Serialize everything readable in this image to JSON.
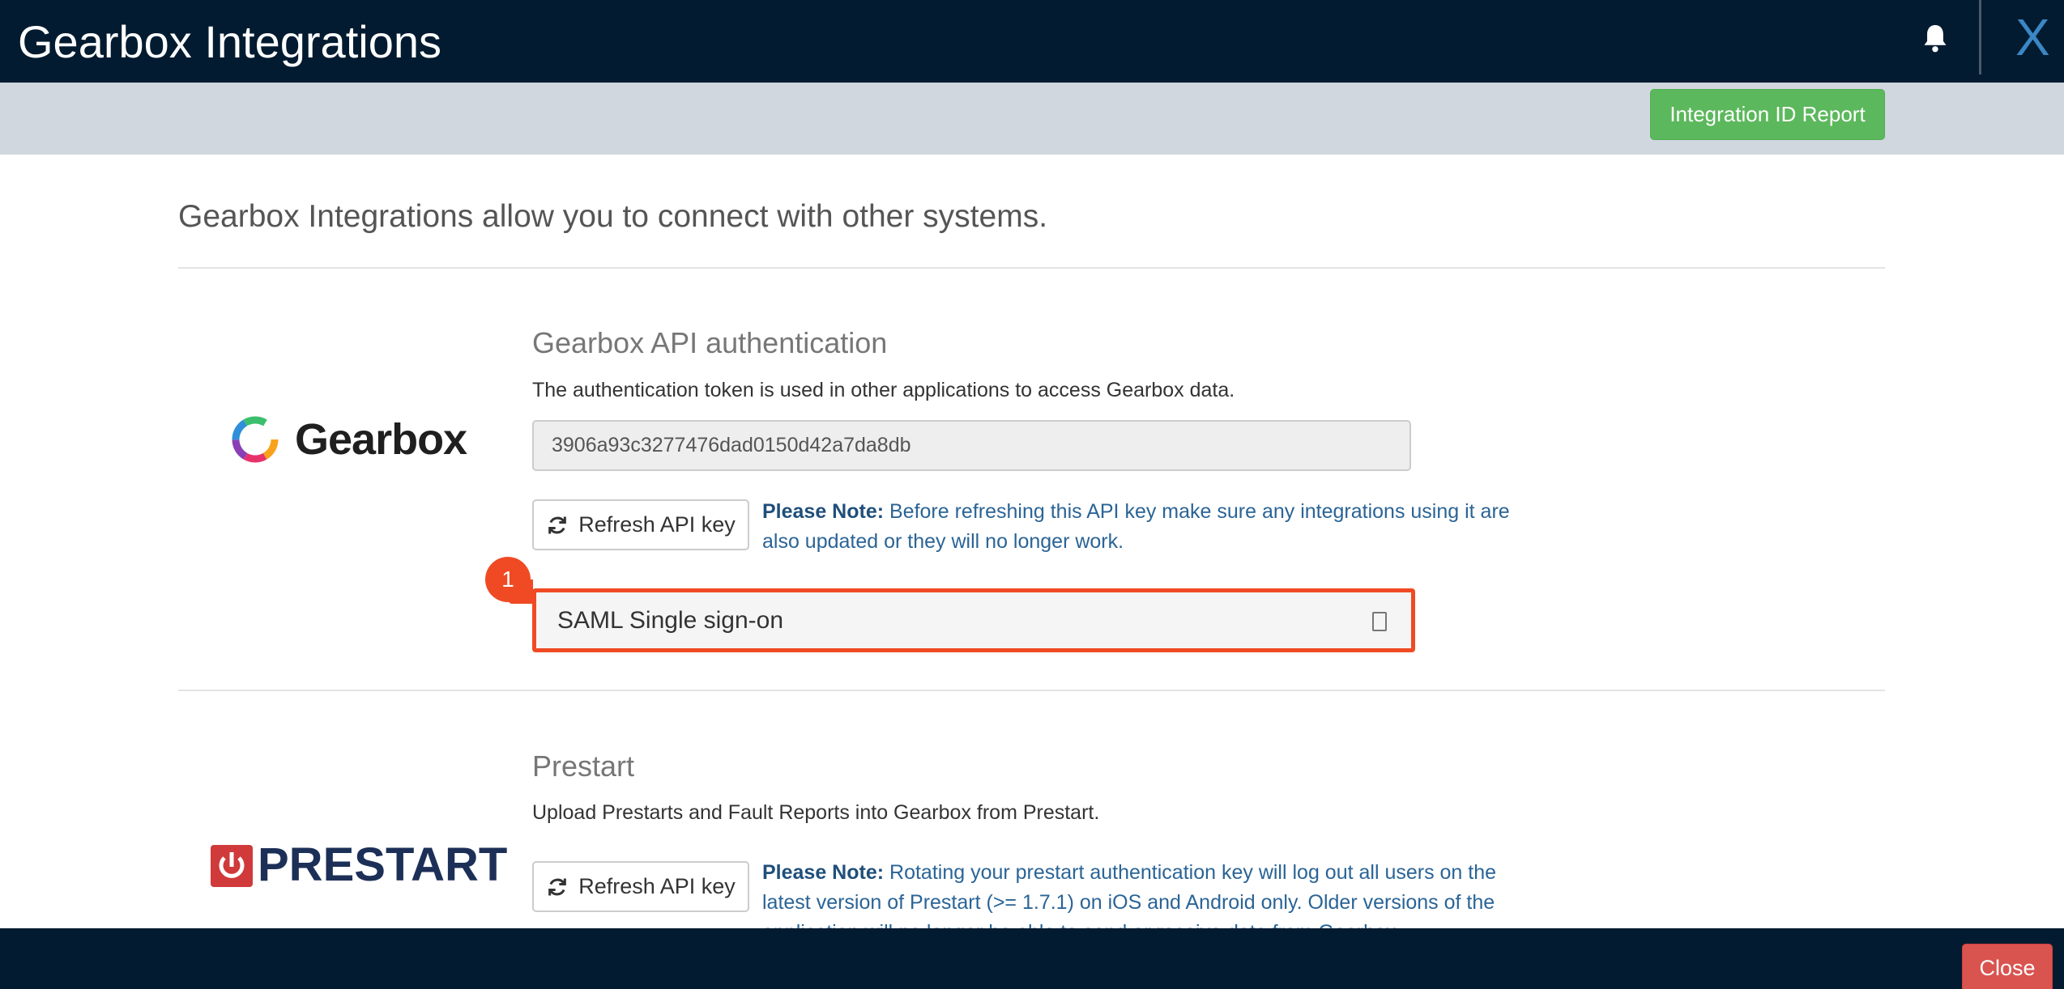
{
  "header": {
    "title": "Gearbox Integrations",
    "bell_icon": "bell-icon",
    "close_label": "X"
  },
  "toolbar": {
    "report_button": "Integration ID Report"
  },
  "intro": "Gearbox Integrations allow you to connect with other systems.",
  "gearbox_section": {
    "logo_text": "Gearbox",
    "title": "Gearbox API authentication",
    "description": "The authentication token is used in other applications to access Gearbox data.",
    "token_value": "3906a93c3277476dad0150d42a7da8db",
    "refresh_button": "Refresh API key",
    "note_label": "Please Note:",
    "note_text": " Before refreshing this API key make sure any integrations using it are also updated or they will no longer work.",
    "saml_panel_title": "SAML Single sign-on",
    "badge": "1"
  },
  "prestart_section": {
    "logo_text": "PRESTART",
    "title": "Prestart",
    "description": "Upload Prestarts and Fault Reports into Gearbox from Prestart.",
    "refresh_button": "Refresh API key",
    "note_label": "Please Note:",
    "note_text": " Rotating your prestart authentication key will log out all users on the latest version of Prestart (>= 1.7.1) on iOS and Android only. Older versions of the application will no longer be able to send or receive data from Gearbox."
  },
  "footer": {
    "close_button": "Close"
  },
  "colors": {
    "header_bg": "#021b30",
    "accent_green": "#5cb85c",
    "highlight": "#f04a24",
    "close_red": "#d9534f",
    "note_blue": "#2a6496"
  }
}
